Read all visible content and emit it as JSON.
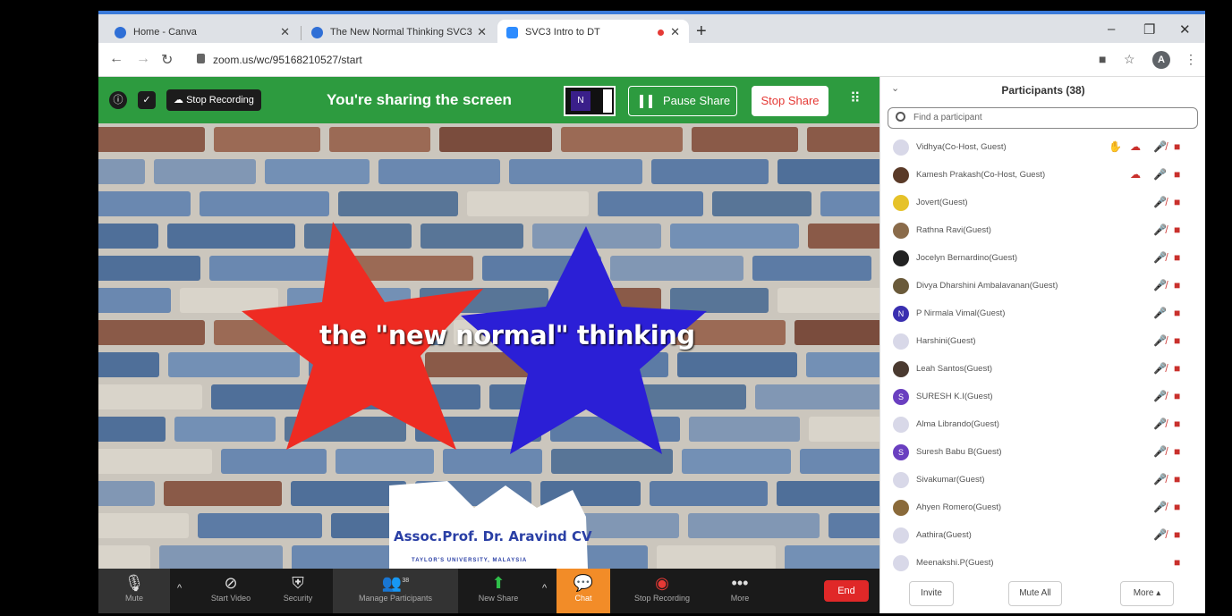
{
  "browser": {
    "tabs": [
      {
        "label": "Home - Canva",
        "color": "#2f6fd6"
      },
      {
        "label": "The New Normal Thinking SVC3",
        "color": "#2f6fd6"
      },
      {
        "label": "SVC3 Intro to DT",
        "color": "#2d8cff"
      }
    ],
    "url": "zoom.us/wc/95168210527/start",
    "profile_initial": "A"
  },
  "share_bar": {
    "stop_recording": "Stop Recording",
    "status": "You're sharing the screen",
    "thumb_initial": "N",
    "pause_share": "Pause Share",
    "stop_share": "Stop Share"
  },
  "slide": {
    "headline": "the \"new normal\" thinking",
    "name": "Assoc.Prof. Dr. Aravind CV",
    "affiliation": "TAYLOR'S UNIVERSITY, MALAYSIA",
    "colors": {
      "red_star": "#ee2b22",
      "blue_star": "#2b1fd6"
    }
  },
  "toolbar": {
    "mute": "Mute",
    "start_video": "Start Video",
    "security": "Security",
    "manage_participants": "Manage Participants",
    "participant_count": "38",
    "new_share": "New Share",
    "chat": "Chat",
    "stop_recording": "Stop Recording",
    "more": "More",
    "end": "End"
  },
  "participants": {
    "title": "Participants (38)",
    "search_placeholder": "Find a participant",
    "list": [
      {
        "name": "Vidhya(Co-Host, Guest)",
        "avatar_color": "#d8d8e8",
        "initial": "",
        "hand": true,
        "cloud": true,
        "mic": "off"
      },
      {
        "name": "Kamesh Prakash(Co-Host, Guest)",
        "avatar_color": "#5a3a28",
        "initial": "",
        "hand": false,
        "cloud": true,
        "mic": "muted-gray"
      },
      {
        "name": "Jovert(Guest)",
        "avatar_color": "#e6c229",
        "initial": "",
        "hand": false,
        "cloud": false,
        "mic": "off"
      },
      {
        "name": "Rathna Ravi(Guest)",
        "avatar_color": "#8a6b4a",
        "initial": "",
        "hand": false,
        "cloud": false,
        "mic": "off"
      },
      {
        "name": "Jocelyn Bernardino(Guest)",
        "avatar_color": "#222222",
        "initial": "",
        "hand": false,
        "cloud": false,
        "mic": "off"
      },
      {
        "name": "Divya Dharshini Ambalavanan(Guest)",
        "avatar_color": "#6a5a3a",
        "initial": "",
        "hand": false,
        "cloud": false,
        "mic": "off"
      },
      {
        "name": "P Nirmala Vimal(Guest)",
        "avatar_color": "#3a2fb0",
        "initial": "N",
        "hand": false,
        "cloud": false,
        "mic": "on"
      },
      {
        "name": "Harshini(Guest)",
        "avatar_color": "#d8d8e8",
        "initial": "",
        "hand": false,
        "cloud": false,
        "mic": "off"
      },
      {
        "name": "Leah Santos(Guest)",
        "avatar_color": "#4a3a30",
        "initial": "",
        "hand": false,
        "cloud": false,
        "mic": "off"
      },
      {
        "name": "SURESH K.I(Guest)",
        "avatar_color": "#6a3fc0",
        "initial": "S",
        "hand": false,
        "cloud": false,
        "mic": "off"
      },
      {
        "name": "Alma Librando(Guest)",
        "avatar_color": "#d8d8e8",
        "initial": "",
        "hand": false,
        "cloud": false,
        "mic": "off"
      },
      {
        "name": "Suresh Babu B(Guest)",
        "avatar_color": "#6a3fc0",
        "initial": "S",
        "hand": false,
        "cloud": false,
        "mic": "off"
      },
      {
        "name": "Sivakumar(Guest)",
        "avatar_color": "#d8d8e8",
        "initial": "",
        "hand": false,
        "cloud": false,
        "mic": "off"
      },
      {
        "name": "Ahyen Romero(Guest)",
        "avatar_color": "#8a6a3a",
        "initial": "",
        "hand": false,
        "cloud": false,
        "mic": "off"
      },
      {
        "name": "Aathira(Guest)",
        "avatar_color": "#d8d8e8",
        "initial": "",
        "hand": false,
        "cloud": false,
        "mic": "off"
      },
      {
        "name": "Meenakshi.P(Guest)",
        "avatar_color": "#d8d8e8",
        "initial": "",
        "hand": false,
        "cloud": false,
        "mic": "none"
      }
    ],
    "invite": "Invite",
    "mute_all": "Mute All",
    "more": "More ▴"
  }
}
